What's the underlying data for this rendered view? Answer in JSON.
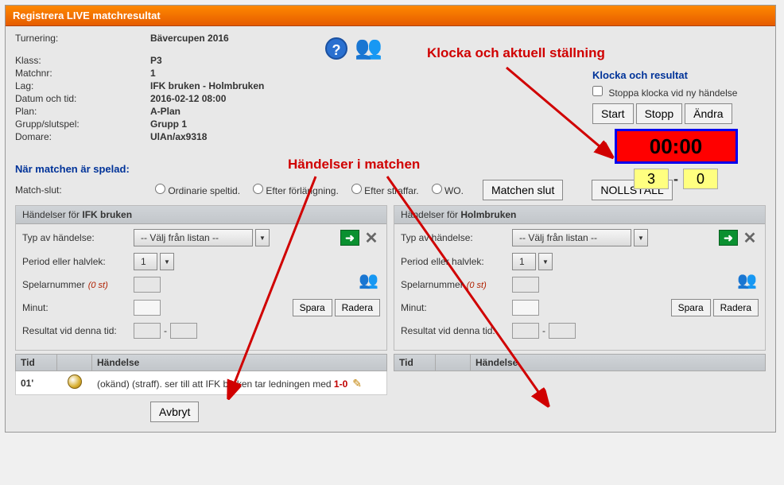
{
  "titlebar": "Registrera LIVE matchresultat",
  "annotations": {
    "clock": "Klocka och aktuell ställning",
    "events": "Händelser i matchen"
  },
  "info": {
    "tournament_label": "Turnering:",
    "tournament": "Bävercupen 2016",
    "class_label": "Klass:",
    "class": "P3",
    "matchnr_label": "Matchnr:",
    "matchnr": "1",
    "teams_label": "Lag:",
    "teams": "IFK bruken - Holmbruken",
    "datetime_label": "Datum och tid:",
    "datetime": "2016-02-12 08:00",
    "field_label": "Plan:",
    "field": "A-Plan",
    "group_label": "Grupp/slutspel:",
    "group": "Grupp 1",
    "ref_label": "Domare:",
    "ref": "UlAn/ax9318"
  },
  "clock": {
    "title": "Klocka och resultat",
    "stop_on_event": "Stoppa klocka vid ny händelse",
    "start": "Start",
    "stop": "Stopp",
    "edit": "Ändra",
    "time": "00:00",
    "score_home": "3",
    "score_away": "0",
    "dash": "-"
  },
  "played": {
    "heading": "När matchen är spelad:",
    "end_label": "Match-slut:",
    "r1": "Ordinarie speltid.",
    "r2": "Efter förlängning.",
    "r3": "Efter straffar.",
    "r4": "WO.",
    "btn_end": "Matchen slut",
    "btn_reset": "NOLLSTÄLL"
  },
  "team_home": "IFK bruken",
  "team_away": "Holmbruken",
  "events_prefix": "Händelser för ",
  "panel": {
    "type_label": "Typ av händelse:",
    "type_placeholder": "-- Välj från listan --",
    "period_label": "Period eller halvlek:",
    "period_value": "1",
    "playernum_label": "Spelarnummer",
    "playernum_count": "(0 st)",
    "minute_label": "Minut:",
    "save": "Spara",
    "delete": "Radera",
    "result_at_label": "Resultat vid denna tid:",
    "dash": "-"
  },
  "event_table": {
    "col_time": "Tid",
    "col_icon": "",
    "col_event": "Händelse",
    "row1_time": "01'",
    "row1_text_a": "(okänd) (straff). ser till att IFK bruken tar ledningen med ",
    "row1_text_b": "1-0"
  },
  "cancel": "Avbryt"
}
